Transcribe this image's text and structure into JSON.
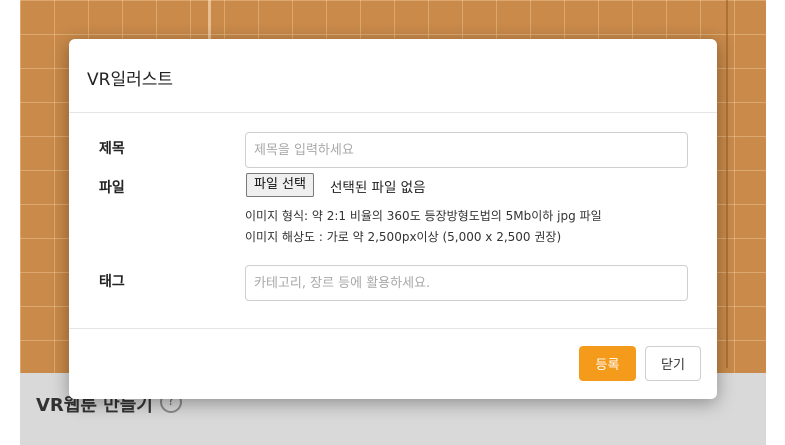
{
  "background": {
    "page_title": "VR웹툰 만들기",
    "help_icon": "?"
  },
  "modal": {
    "title": "VR일러스트",
    "fields": {
      "title": {
        "label": "제목",
        "placeholder": "제목을 입력하세요"
      },
      "file": {
        "label": "파일",
        "button_label": "파일 선택",
        "status": "선택된 파일 없음",
        "hint_format": "이미지 형식: 약 2:1 비율의 360도 등장방형도법의 5Mb이하 jpg 파일",
        "hint_resolution": "이미지 해상도 : 가로 약 2,500px이상 (5,000 x 2,500 권장)"
      },
      "tag": {
        "label": "태그",
        "placeholder": "카테고리, 장르 등에 활용하세요."
      }
    },
    "buttons": {
      "submit": "등록",
      "close": "닫기"
    }
  },
  "colors": {
    "accent": "#f59b1c",
    "backdrop": "#c98a4a"
  }
}
